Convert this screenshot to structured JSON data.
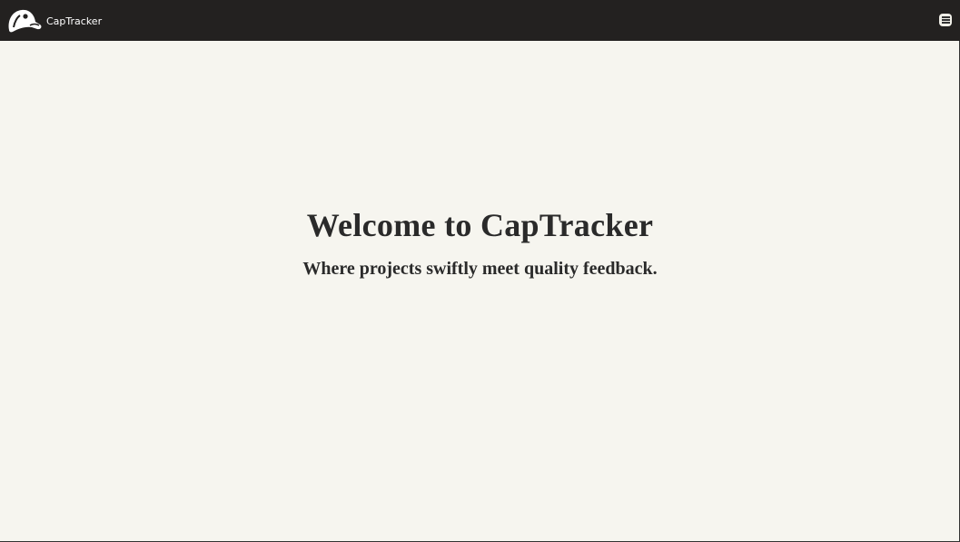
{
  "navbar": {
    "brand": "CapTracker",
    "logo_icon": "cap-icon",
    "menu_icon": "hamburger-menu-icon"
  },
  "hero": {
    "title": "Welcome to CapTracker",
    "subtitle": "Where projects swiftly meet quality feedback."
  }
}
